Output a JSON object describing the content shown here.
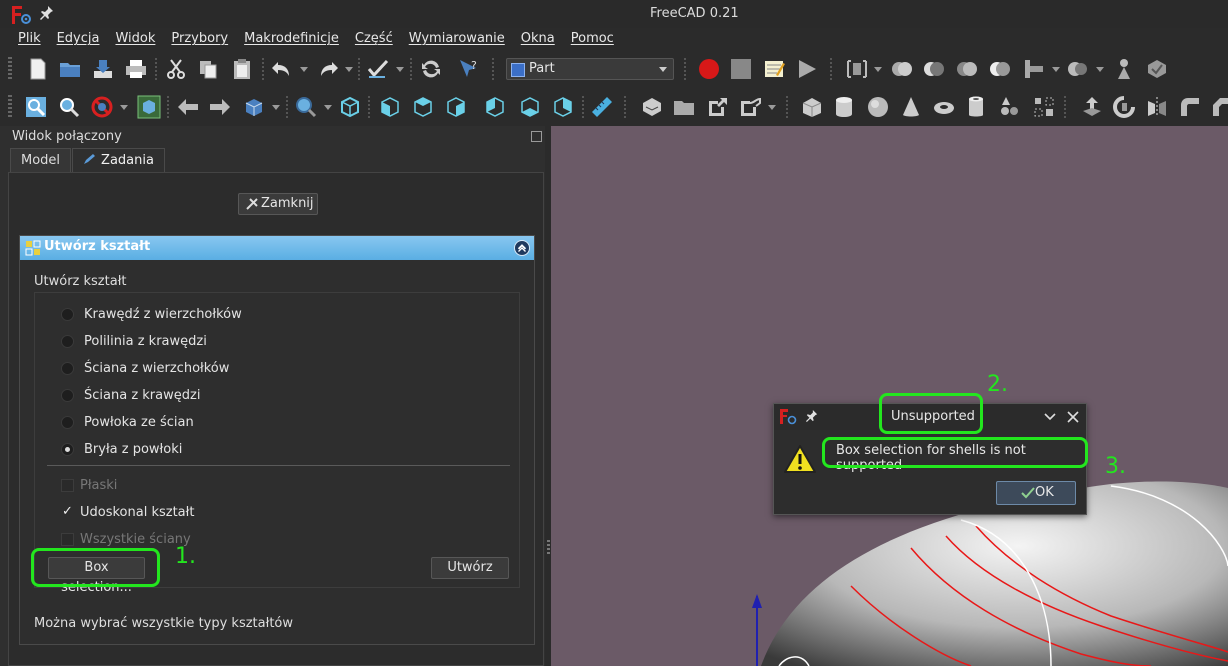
{
  "window": {
    "title": "FreeCAD 0.21"
  },
  "menu": [
    "Plik",
    "Edycja",
    "Widok",
    "Przybory",
    "Makrodefinicje",
    "Część",
    "Wymiarowanie",
    "Okna",
    "Pomoc"
  ],
  "toolbar": {
    "workbench": "Part"
  },
  "combo_view": {
    "title": "Widok połączony",
    "tabs": [
      {
        "label": "Model"
      },
      {
        "label": "Zadania"
      }
    ],
    "close_label": "Zamknij",
    "task_box": {
      "title": "Utwórz kształt",
      "group_label": "Utwórz kształt",
      "options": [
        {
          "label": "Krawędź z wierzchołków",
          "checked": false
        },
        {
          "label": "Polilinia z krawędzi",
          "checked": false
        },
        {
          "label": "Ściana z wierzchołków",
          "checked": false
        },
        {
          "label": "Ściana z krawędzi",
          "checked": false
        },
        {
          "label": "Powłoka ze ścian",
          "checked": false
        },
        {
          "label": "Bryła z powłoki",
          "checked": true
        }
      ],
      "checks": [
        {
          "label": "Płaski",
          "checked": false,
          "disabled": true
        },
        {
          "label": "Udoskonal kształt",
          "checked": true,
          "disabled": false
        },
        {
          "label": "Wszystkie ściany",
          "checked": false,
          "disabled": true
        }
      ],
      "box_selection_label": "Box selection...",
      "create_label": "Utwórz",
      "hint": "Można wybrać wszystkie typy kształtów"
    }
  },
  "dialog": {
    "title": "Unsupported",
    "message": "Box selection for shells is not supported",
    "ok_label": "OK"
  },
  "annotations": [
    "1.",
    "2.",
    "3."
  ],
  "colors": {
    "highlight": "#23e61e",
    "view_bg": "#6b5a67",
    "header": "#5aaee3"
  }
}
